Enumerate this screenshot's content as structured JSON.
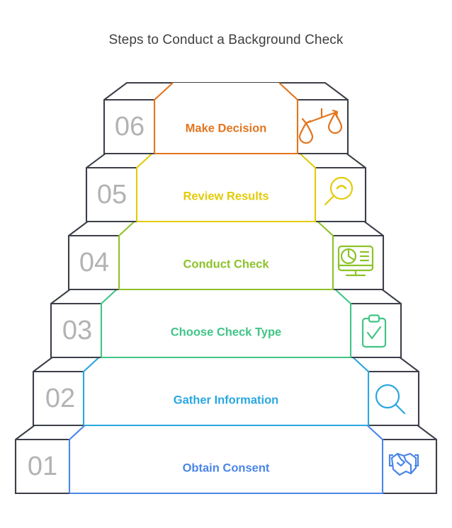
{
  "header": {
    "title": "Steps to Conduct a Background Check"
  },
  "diagram": {
    "type": "staircase-steps",
    "orientation": "ascending-bottom-to-top",
    "background": "#ffffff",
    "frame_color": "#3c3f48",
    "number_color": "#b3b3b3",
    "title_color": "#404040"
  },
  "steps": [
    {
      "number": "06",
      "label": "Make Decision",
      "color": "#e2751f",
      "icon": "balance-scales-icon",
      "level": 6
    },
    {
      "number": "05",
      "label": "Review Results",
      "color": "#e3cb08",
      "icon": "magnifier-chart-icon",
      "level": 5
    },
    {
      "number": "04",
      "label": "Conduct Check",
      "color": "#8cc229",
      "icon": "monitor-dashboard-icon",
      "level": 4
    },
    {
      "number": "03",
      "label": "Choose Check Type",
      "color": "#40c487",
      "icon": "clipboard-check-icon",
      "level": 3
    },
    {
      "number": "02",
      "label": "Gather Information",
      "color": "#2ba7df",
      "icon": "magnifier-icon",
      "level": 2
    },
    {
      "number": "01",
      "label": "Obtain Consent",
      "color": "#4a86e8",
      "icon": "handshake-icon",
      "level": 1
    }
  ]
}
